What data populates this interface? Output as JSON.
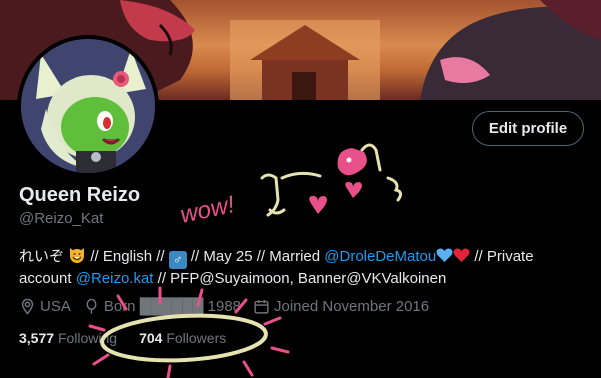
{
  "profile": {
    "edit_label": "Edit profile",
    "display_name": "Queen Reizo",
    "handle": "@Reizo_Kat"
  },
  "bio": {
    "part1": "れいぞ ",
    "part2": " // English // ",
    "male_symbol": "♂",
    "part3": " // May 25 // Married ",
    "mention1": "@DroleDeMatou",
    "part4": " // Private account ",
    "mention2": "@Reizo.kat",
    "part5": " // PFP@Suyaimoon, Banner@VKValkoinen"
  },
  "meta": {
    "location": "USA",
    "born": "Born ██████ 1988",
    "joined": "Joined November 2016"
  },
  "stats": {
    "following_count": "3,577",
    "following_label": "Following",
    "followers_count": "704",
    "followers_label": "Followers"
  },
  "doodle": {
    "text": "wow!"
  },
  "colors": {
    "link": "#1d9bf0",
    "muted": "#71767b",
    "doodle_pink": "#e8508a",
    "doodle_cream": "#e6e3b0"
  }
}
